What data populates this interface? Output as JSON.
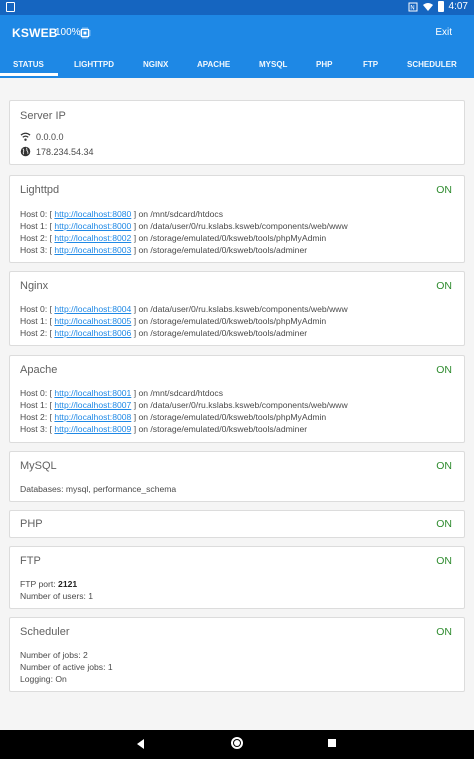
{
  "statusbar": {
    "time": "4:07"
  },
  "app": {
    "title": "KSWEB",
    "percent": "100%",
    "exit_label": "Exit"
  },
  "tabs": [
    {
      "label": "STATUS"
    },
    {
      "label": "LIGHTTPD"
    },
    {
      "label": "NGINX"
    },
    {
      "label": "APACHE"
    },
    {
      "label": "MYSQL"
    },
    {
      "label": "PHP"
    },
    {
      "label": "FTP"
    },
    {
      "label": "SCHEDULER"
    }
  ],
  "server_ip": {
    "title": "Server IP",
    "wifi_ip": "0.0.0.0",
    "public_ip": "178.234.54.34"
  },
  "lighttpd": {
    "title": "Lighttpd",
    "status": "ON",
    "hosts": [
      {
        "prefix": "Host 0: [ ",
        "url": "http://localhost:8080",
        "suffix": " ] on /mnt/sdcard/htdocs"
      },
      {
        "prefix": "Host 1: [ ",
        "url": "http://localhost:8000",
        "suffix": " ] on /data/user/0/ru.kslabs.ksweb/components/web/www"
      },
      {
        "prefix": "Host 2: [ ",
        "url": "http://localhost:8002",
        "suffix": " ] on /storage/emulated/0/ksweb/tools/phpMyAdmin"
      },
      {
        "prefix": "Host 3: [ ",
        "url": "http://localhost:8003",
        "suffix": " ] on /storage/emulated/0/ksweb/tools/adminer"
      }
    ]
  },
  "nginx": {
    "title": "Nginx",
    "status": "ON",
    "hosts": [
      {
        "prefix": "Host 0: [ ",
        "url": "http://localhost:8004",
        "suffix": " ] on /data/user/0/ru.kslabs.ksweb/components/web/www"
      },
      {
        "prefix": "Host 1: [ ",
        "url": "http://localhost:8005",
        "suffix": " ] on /storage/emulated/0/ksweb/tools/phpMyAdmin"
      },
      {
        "prefix": "Host 2: [ ",
        "url": "http://localhost:8006",
        "suffix": " ] on /storage/emulated/0/ksweb/tools/adminer"
      }
    ]
  },
  "apache": {
    "title": "Apache",
    "status": "ON",
    "hosts": [
      {
        "prefix": "Host 0: [ ",
        "url": "http://localhost:8001",
        "suffix": " ] on /mnt/sdcard/htdocs"
      },
      {
        "prefix": "Host 1: [ ",
        "url": "http://localhost:8007",
        "suffix": " ] on /data/user/0/ru.kslabs.ksweb/components/web/www"
      },
      {
        "prefix": "Host 2: [ ",
        "url": "http://localhost:8008",
        "suffix": " ] on /storage/emulated/0/ksweb/tools/phpMyAdmin"
      },
      {
        "prefix": "Host 3: [ ",
        "url": "http://localhost:8009",
        "suffix": " ] on /storage/emulated/0/ksweb/tools/adminer"
      }
    ]
  },
  "mysql": {
    "title": "MySQL",
    "status": "ON",
    "databases": "Databases: mysql, performance_schema"
  },
  "php": {
    "title": "PHP",
    "status": "ON"
  },
  "ftp": {
    "title": "FTP",
    "status": "ON",
    "port_label": "FTP port: ",
    "port_value": "2121",
    "users": "Number of users: 1"
  },
  "scheduler": {
    "title": "Scheduler",
    "status": "ON",
    "jobs": "Number of jobs: 2",
    "active_jobs": "Number of active jobs: 1",
    "logging": "Logging: On"
  }
}
